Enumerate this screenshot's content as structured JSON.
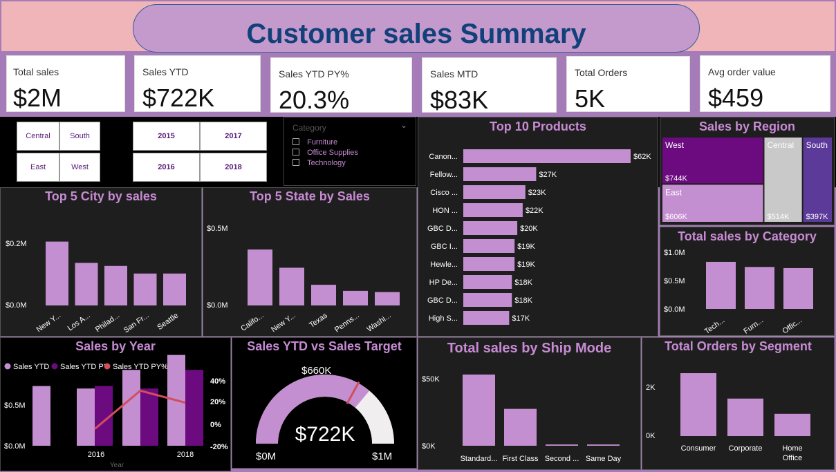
{
  "title": "Customer sales Summary",
  "colors": {
    "bar": "#c48fd0",
    "dark_purple": "#6b0b7f",
    "line": "#d44d5c",
    "panel": "#1f1e1f",
    "gray": "#c9c9c9",
    "violet": "#5b3a9a"
  },
  "kpis": [
    {
      "label": "Total sales",
      "value": "$2M"
    },
    {
      "label": "Sales YTD",
      "value": "$722K"
    },
    {
      "label": "Sales YTD PY%",
      "value": "20.3%"
    },
    {
      "label": "Sales MTD",
      "value": "$83K"
    },
    {
      "label": "Total Orders",
      "value": "5K"
    },
    {
      "label": "Avg order value",
      "value": "$459"
    }
  ],
  "region_slicer": [
    "Central",
    "South",
    "East",
    "West"
  ],
  "year_slicer": [
    "2015",
    "2017",
    "2016",
    "2018"
  ],
  "category_slicer": {
    "header": "Category",
    "items": [
      "Furniture",
      "Office Supplies",
      "Technology"
    ]
  },
  "chart_data": [
    {
      "id": "top_products",
      "type": "bar",
      "orientation": "horizontal",
      "title": "Top 10 Products",
      "categories": [
        "Canon...",
        "Fellow...",
        "Cisco ...",
        "HON ...",
        "GBC D...",
        "GBC I...",
        "Hewle...",
        "HP De...",
        "GBC D...",
        "High S..."
      ],
      "values": [
        62,
        27,
        23,
        22,
        20,
        19,
        19,
        18,
        18,
        17
      ],
      "data_labels": [
        "$62K",
        "$27K",
        "$23K",
        "$22K",
        "$20K",
        "$19K",
        "$19K",
        "$18K",
        "$18K",
        "$17K"
      ]
    },
    {
      "id": "region_treemap",
      "type": "treemap",
      "title": "Sales by Region",
      "categories": [
        "West",
        "East",
        "Central",
        "South"
      ],
      "data_labels": [
        "$744K",
        "$606K",
        "$514K",
        "$397K"
      ],
      "values": [
        744,
        606,
        514,
        397
      ]
    },
    {
      "id": "city",
      "type": "bar",
      "title": "Top 5 City by sales",
      "categories": [
        "New Y...",
        "Los A...",
        "Philad...",
        "San Fr...",
        "Seattle"
      ],
      "values": [
        0.21,
        0.14,
        0.13,
        0.105,
        0.105
      ],
      "ylim": [
        0,
        0.2
      ],
      "yticks": [
        "$0.0M",
        "$0.2M"
      ]
    },
    {
      "id": "state",
      "type": "bar",
      "title": "Top 5 State by Sales",
      "categories": [
        "Califo...",
        "New Y...",
        "Texas",
        "Penns...",
        "Washi..."
      ],
      "values": [
        0.46,
        0.31,
        0.17,
        0.12,
        0.11
      ],
      "ylim": [
        0,
        0.5
      ],
      "yticks": [
        "$0.0M",
        "$0.5M"
      ]
    },
    {
      "id": "category",
      "type": "bar",
      "title": "Total sales by Category",
      "categories": [
        "Tech...",
        "Furn...",
        "Offic..."
      ],
      "values": [
        0.83,
        0.74,
        0.72
      ],
      "ylim": [
        0,
        1.0
      ],
      "yticks": [
        "$0.0M",
        "$0.5M",
        "$1.0M"
      ]
    },
    {
      "id": "by_year",
      "type": "bar+line",
      "title": "Sales by Year",
      "legend": [
        "Sales YTD",
        "Sales YTD PY",
        "Sales YTD PY%"
      ],
      "x_ticks": [
        "2016",
        "2018"
      ],
      "xlabel": "Year",
      "categories": [
        "2015",
        "2016",
        "2017",
        "2018"
      ],
      "series": [
        {
          "name": "Sales YTD",
          "values": [
            0.48,
            0.46,
            0.61,
            0.73
          ]
        },
        {
          "name": "Sales YTD PY",
          "values": [
            null,
            0.48,
            0.46,
            0.61
          ]
        },
        {
          "name": "Sales YTD PY%",
          "values": [
            null,
            -4,
            31,
            20
          ]
        }
      ],
      "yticks_left": [
        "$0.0M",
        "$0.5M"
      ],
      "yticks_right": [
        "40%",
        "20%",
        "0%",
        "-20%"
      ]
    },
    {
      "id": "gauge",
      "type": "gauge",
      "title": "Sales YTD vs Sales Target",
      "value": 722,
      "target": 660,
      "min": 0,
      "max": 1000,
      "value_label": "$722K",
      "target_label": "$660K",
      "min_label": "$0M",
      "max_label": "$1M"
    },
    {
      "id": "ship_mode",
      "type": "bar",
      "title": "Total sales by Ship Mode",
      "categories": [
        "Standard...",
        "First Class",
        "Second ...",
        "Same Day"
      ],
      "values": [
        56,
        29,
        1,
        1
      ],
      "ylim": [
        0,
        50
      ],
      "yticks": [
        "$0K",
        "$50K"
      ]
    },
    {
      "id": "segment",
      "type": "bar",
      "title": "Total Orders by Segment",
      "categories": [
        "Consumer",
        "Corporate",
        "Home Office"
      ],
      "values": [
        2.6,
        1.55,
        0.92
      ],
      "ylim": [
        0,
        2
      ],
      "yticks": [
        "0K",
        "2K"
      ]
    }
  ]
}
